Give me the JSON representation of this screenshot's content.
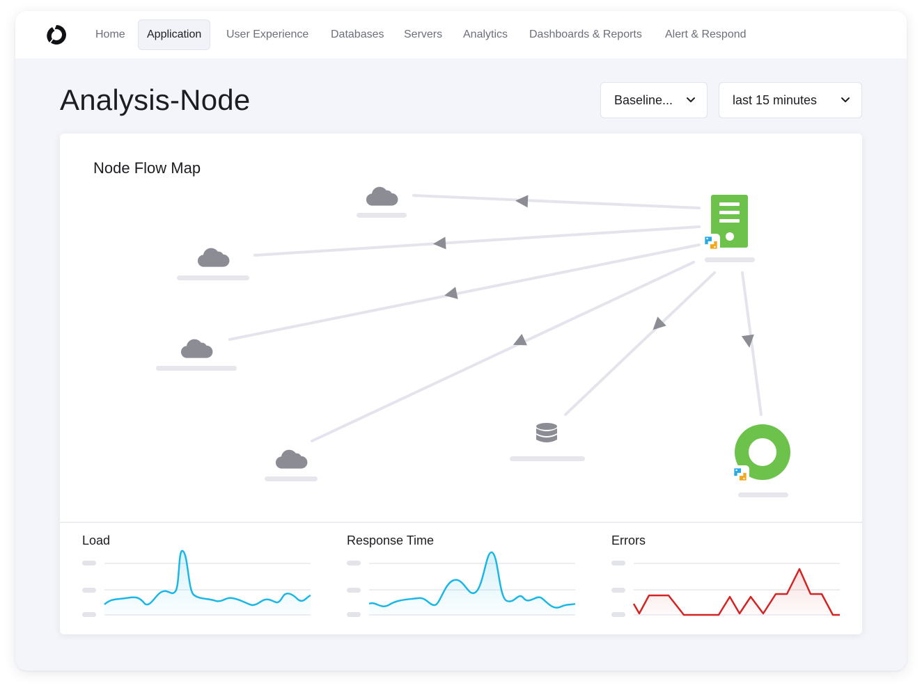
{
  "nav": {
    "items": [
      {
        "id": "home",
        "label": "Home",
        "active": false
      },
      {
        "id": "application",
        "label": "Application",
        "active": true
      },
      {
        "id": "user-experience",
        "label": "User Experience",
        "active": false
      },
      {
        "id": "databases",
        "label": "Databases",
        "active": false
      },
      {
        "id": "servers",
        "label": "Servers",
        "active": false
      },
      {
        "id": "analytics",
        "label": "Analytics",
        "active": false
      },
      {
        "id": "dashboards",
        "label": "Dashboards & Reports",
        "active": false
      },
      {
        "id": "alert",
        "label": "Alert & Respond",
        "active": false
      }
    ]
  },
  "page": {
    "title": "Analysis-Node"
  },
  "filters": {
    "baseline": "Baseline...",
    "time_range": "last 15 minutes"
  },
  "flow_map": {
    "title": "Node Flow Map",
    "node_icons": [
      "cloud-icon",
      "server-icon",
      "database-icon",
      "python-icon",
      "ring-icon"
    ]
  },
  "metrics": [
    {
      "id": "load",
      "title": "Load",
      "color": "#1ab7e6"
    },
    {
      "id": "response-time",
      "title": "Response Time",
      "color": "#1ab7e6"
    },
    {
      "id": "errors",
      "title": "Errors",
      "color": "#d42323"
    }
  ],
  "colors": {
    "accent_green": "#6cc24a",
    "icon_gray": "#8b8c94",
    "edge_gray": "#e4e4ec",
    "load_line": "#1ab7e6",
    "error_line": "#d42323"
  }
}
